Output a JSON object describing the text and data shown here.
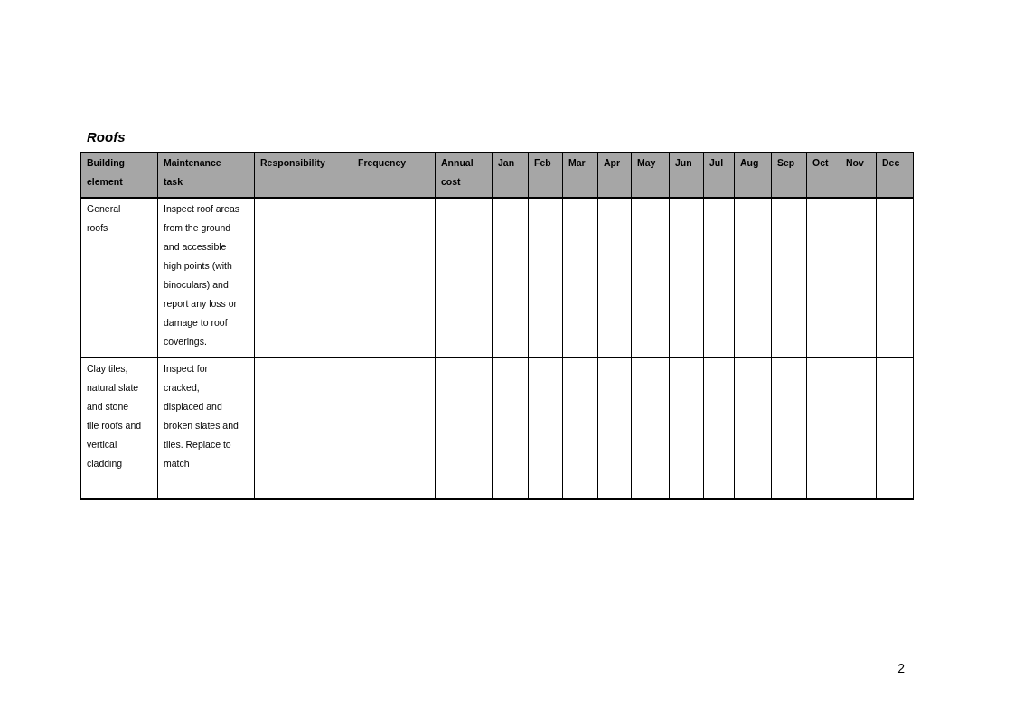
{
  "section_title": "Roofs",
  "table": {
    "columns": [
      "Building element",
      "Maintenance task",
      "Responsibility",
      "Frequency",
      "Annual cost",
      "Jan",
      "Feb",
      "Mar",
      "Apr",
      "May",
      "Jun",
      "Jul",
      "Aug",
      "Sep",
      "Oct",
      "Nov",
      "Dec"
    ],
    "rows": [
      {
        "building_element": "General roofs",
        "maintenance_task": "Inspect roof areas from the ground and accessible high points (with binoculars) and report any loss or damage to roof coverings."
      },
      {
        "building_element": "Clay tiles, natural slate and stone tile roofs and vertical cladding",
        "maintenance_task": "Inspect for cracked, displaced and broken slates and tiles. Replace to match"
      }
    ]
  },
  "page_number": "2"
}
